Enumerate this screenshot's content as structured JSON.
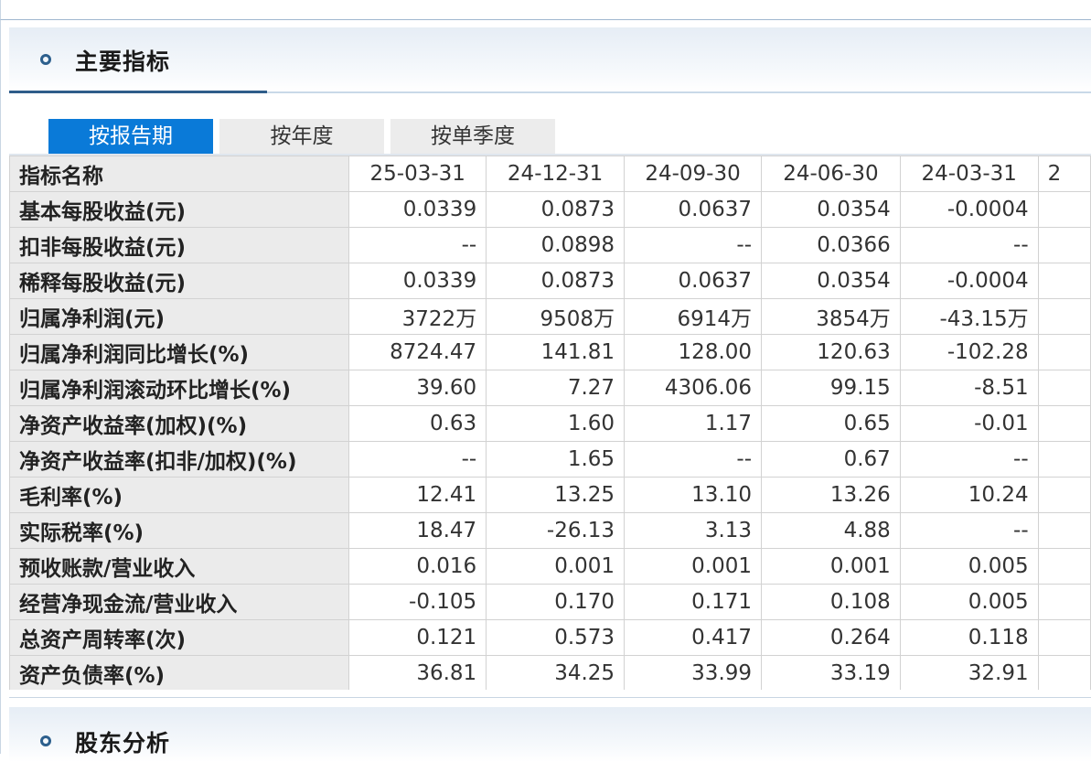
{
  "section1": {
    "title": "主要指标"
  },
  "section2": {
    "title": "股东分析"
  },
  "tabs": [
    {
      "label": "按报告期",
      "active": true
    },
    {
      "label": "按年度",
      "active": false
    },
    {
      "label": "按单季度",
      "active": false
    }
  ],
  "colors": {
    "tab_active": "#0a7ad8",
    "name_col_bg": "#ebebeb",
    "header_accent": "#2c5f8d"
  },
  "table": {
    "name_header": "指标名称",
    "periods": [
      "25-03-31",
      "24-12-31",
      "24-09-30",
      "24-06-30",
      "24-03-31",
      "2"
    ],
    "rows": [
      {
        "name": "基本每股收益(元)",
        "values": [
          "0.0339",
          "0.0873",
          "0.0637",
          "0.0354",
          "-0.0004",
          ""
        ]
      },
      {
        "name": "扣非每股收益(元)",
        "values": [
          "--",
          "0.0898",
          "--",
          "0.0366",
          "--",
          ""
        ]
      },
      {
        "name": "稀释每股收益(元)",
        "values": [
          "0.0339",
          "0.0873",
          "0.0637",
          "0.0354",
          "-0.0004",
          ""
        ]
      },
      {
        "name": "归属净利润(元)",
        "values": [
          "3722万",
          "9508万",
          "6914万",
          "3854万",
          "-43.15万",
          ""
        ]
      },
      {
        "name": "归属净利润同比增长(%)",
        "values": [
          "8724.47",
          "141.81",
          "128.00",
          "120.63",
          "-102.28",
          ""
        ]
      },
      {
        "name": "归属净利润滚动环比增长(%)",
        "values": [
          "39.60",
          "7.27",
          "4306.06",
          "99.15",
          "-8.51",
          ""
        ]
      },
      {
        "name": "净资产收益率(加权)(%)",
        "values": [
          "0.63",
          "1.60",
          "1.17",
          "0.65",
          "-0.01",
          ""
        ]
      },
      {
        "name": "净资产收益率(扣非/加权)(%)",
        "values": [
          "--",
          "1.65",
          "--",
          "0.67",
          "--",
          ""
        ]
      },
      {
        "name": "毛利率(%)",
        "values": [
          "12.41",
          "13.25",
          "13.10",
          "13.26",
          "10.24",
          ""
        ]
      },
      {
        "name": "实际税率(%)",
        "values": [
          "18.47",
          "-26.13",
          "3.13",
          "4.88",
          "--",
          ""
        ]
      },
      {
        "name": "预收账款/营业收入",
        "values": [
          "0.016",
          "0.001",
          "0.001",
          "0.001",
          "0.005",
          ""
        ]
      },
      {
        "name": "经营净现金流/营业收入",
        "values": [
          "-0.105",
          "0.170",
          "0.171",
          "0.108",
          "0.005",
          ""
        ]
      },
      {
        "name": "总资产周转率(次)",
        "values": [
          "0.121",
          "0.573",
          "0.417",
          "0.264",
          "0.118",
          ""
        ]
      },
      {
        "name": "资产负债率(%)",
        "values": [
          "36.81",
          "34.25",
          "33.99",
          "33.19",
          "32.91",
          ""
        ]
      }
    ]
  }
}
